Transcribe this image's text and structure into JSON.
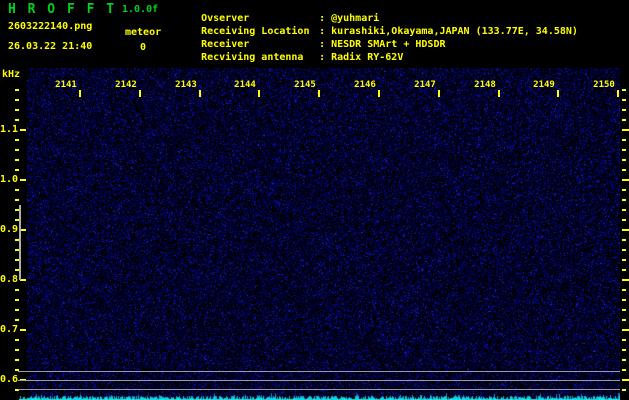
{
  "app": {
    "title": "H R O F F T",
    "version": "1.0.0f"
  },
  "file": {
    "name": "2603222140.png",
    "datetime": "26.03.22 21:40"
  },
  "counter": {
    "label": "meteor",
    "value": "0"
  },
  "header": {
    "colon": ":",
    "rows": [
      {
        "label": "Ovserver",
        "value": "@yuhmari"
      },
      {
        "label": "Receiving Location",
        "value": "kurashiki,Okayama,JAPAN (133.77E, 34.58N)"
      },
      {
        "label": "Receiver",
        "value": "NESDR SMArt + HDSDR"
      },
      {
        "label": "Recviving antenna",
        "value": "Radix RY-62V"
      }
    ]
  },
  "chart_data": {
    "type": "heatmap",
    "subtype": "radio-spectrogram",
    "title": "HROFFT meteor echo spectrogram, 10-minute window starting 26.03.22 21:40",
    "ylabel": "kHz",
    "y_ticks": [
      "1.1",
      "1.0",
      "0.9",
      "0.8",
      "0.7",
      "0.6"
    ],
    "y_minor_step_khz": 0.02,
    "ylim": [
      0.56,
      1.18
    ],
    "x_ticks": [
      "2141",
      "2142",
      "2143",
      "2144",
      "2145",
      "2146",
      "2147",
      "2148",
      "2149",
      "2150"
    ],
    "x_unit": "time HHMM, 1-minute intervals",
    "meteor_echoes": 0,
    "carrier_lines_khz": [
      0.618,
      0.6,
      0.582
    ],
    "calibration_bar_khz": [
      0.8,
      0.95
    ],
    "content": "uniform dark-blue background noise, no meteor echoes visible; three faint horizontal carrier lines around 0.6 kHz; jagged cyan signal-level trace along the bottom edge",
    "colors": {
      "background": "#000000",
      "noise_dot": "#2233cc",
      "text_yellow": "#ffff00",
      "text_green": "#00d020",
      "carrier_line": "#9a9aa0",
      "calibration_bar": "#b0b0b0",
      "signal_trace": "#30e8f0"
    }
  }
}
